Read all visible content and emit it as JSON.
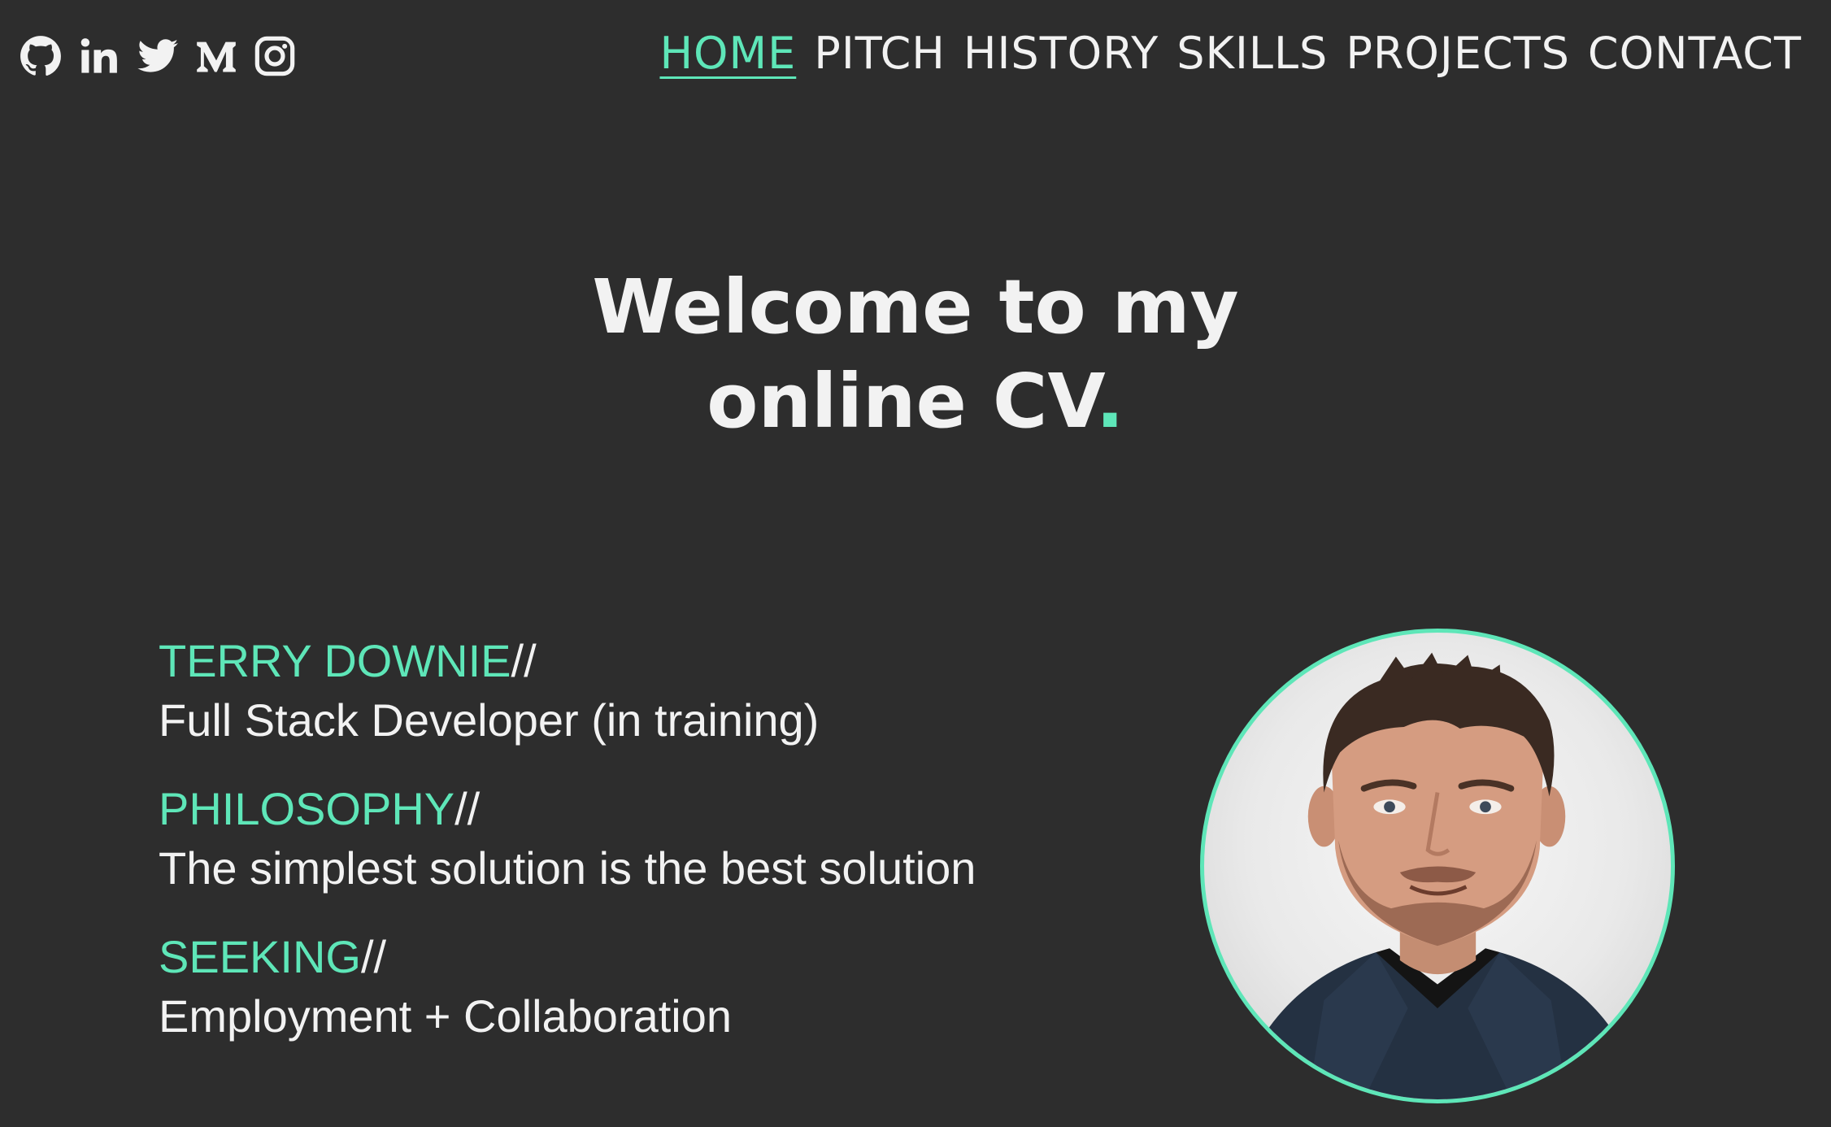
{
  "colors": {
    "background": "#2d2d2d",
    "accent": "#5ee6b8",
    "text": "#f2f2f2"
  },
  "social": [
    {
      "icon": "github-icon"
    },
    {
      "icon": "linkedin-icon"
    },
    {
      "icon": "twitter-icon"
    },
    {
      "icon": "medium-icon"
    },
    {
      "icon": "instagram-icon"
    }
  ],
  "nav": {
    "home": "HOME",
    "pitch": "PITCH",
    "history": "HISTORY",
    "skills": "SKILLS",
    "projects": "PROJECTS",
    "contact": "CONTACT",
    "active": "HOME"
  },
  "hero": {
    "line1": "Welcome to my",
    "line2": "online CV",
    "dot": "."
  },
  "info": {
    "name_label": "TERRY DOWNIE",
    "name_value": "Full Stack Developer (in training)",
    "philosophy_label": "PHILOSOPHY",
    "philosophy_value": "The simplest solution is the best solution",
    "seeking_label": "SEEKING",
    "seeking_value": "Employment + Collaboration",
    "separator": "//"
  }
}
